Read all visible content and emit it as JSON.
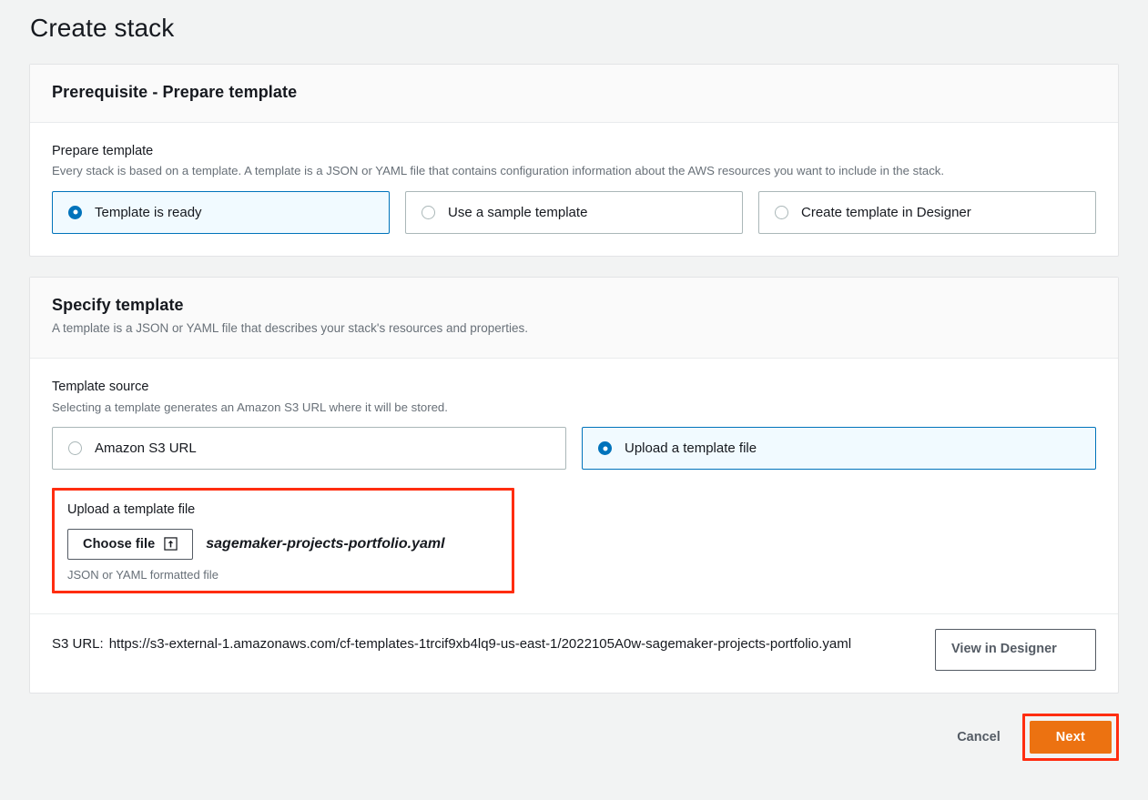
{
  "page": {
    "title": "Create stack"
  },
  "prerequisite_section": {
    "heading": "Prerequisite - Prepare template",
    "field_label": "Prepare template",
    "field_description": "Every stack is based on a template. A template is a JSON or YAML file that contains configuration information about the AWS resources you want to include in the stack.",
    "options": [
      {
        "label": "Template is ready",
        "selected": true
      },
      {
        "label": "Use a sample template",
        "selected": false
      },
      {
        "label": "Create template in Designer",
        "selected": false
      }
    ]
  },
  "specify_section": {
    "heading": "Specify template",
    "subheading": "A template is a JSON or YAML file that describes your stack's resources and properties.",
    "field_label": "Template source",
    "field_description": "Selecting a template generates an Amazon S3 URL where it will be stored.",
    "options": [
      {
        "label": "Amazon S3 URL",
        "selected": false
      },
      {
        "label": "Upload a template file",
        "selected": true
      }
    ],
    "upload": {
      "label": "Upload a template file",
      "choose_button": "Choose file",
      "choose_icon": "upload-icon",
      "file_name": "sagemaker-projects-portfolio.yaml",
      "hint": "JSON or YAML formatted file",
      "highlight_color": "#ff2d10"
    },
    "s3": {
      "key_label": "S3 URL:",
      "url": "https://s3-external-1.amazonaws.com/cf-templates-1trcif9xb4lq9-us-east-1/2022105A0w-sagemaker-projects-portfolio.yaml",
      "designer_button": "View in Designer"
    }
  },
  "footer": {
    "cancel_label": "Cancel",
    "next_label": "Next",
    "next_color": "#ec7211",
    "next_highlight_color": "#ff2d10"
  },
  "theme": {
    "accent_blue": "#0073bb",
    "selected_tile_bg": "#f1faff",
    "page_bg": "#f2f3f3"
  }
}
